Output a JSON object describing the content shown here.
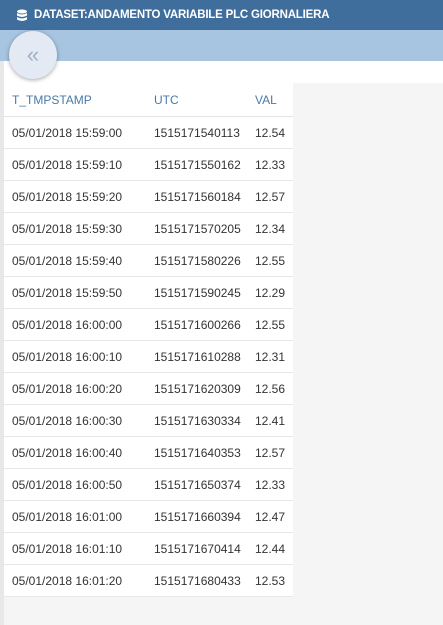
{
  "header": {
    "title": "DATASET:ANDAMENTO VARIABILE PLC GIORNALIERA",
    "icon": "database-icon"
  },
  "collapse_button": {
    "icon": "double-chevron-left-icon",
    "glyph": "«"
  },
  "table": {
    "columns": [
      "T_TMPSTAMP",
      "UTC",
      "VAL"
    ],
    "rows": [
      [
        "05/01/2018 15:59:00",
        "1515171540113",
        "12.54"
      ],
      [
        "05/01/2018 15:59:10",
        "1515171550162",
        "12.33"
      ],
      [
        "05/01/2018 15:59:20",
        "1515171560184",
        "12.57"
      ],
      [
        "05/01/2018 15:59:30",
        "1515171570205",
        "12.34"
      ],
      [
        "05/01/2018 15:59:40",
        "1515171580226",
        "12.55"
      ],
      [
        "05/01/2018 15:59:50",
        "1515171590245",
        "12.29"
      ],
      [
        "05/01/2018 16:00:00",
        "1515171600266",
        "12.55"
      ],
      [
        "05/01/2018 16:00:10",
        "1515171610288",
        "12.31"
      ],
      [
        "05/01/2018 16:00:20",
        "1515171620309",
        "12.56"
      ],
      [
        "05/01/2018 16:00:30",
        "1515171630334",
        "12.41"
      ],
      [
        "05/01/2018 16:00:40",
        "1515171640353",
        "12.57"
      ],
      [
        "05/01/2018 16:00:50",
        "1515171650374",
        "12.33"
      ],
      [
        "05/01/2018 16:01:00",
        "1515171660394",
        "12.47"
      ],
      [
        "05/01/2018 16:01:10",
        "1515171670414",
        "12.44"
      ],
      [
        "05/01/2018 16:01:20",
        "1515171680433",
        "12.53"
      ]
    ]
  },
  "colors": {
    "header_bg": "#3f6e9c",
    "subbar_bg": "#a7c4e0",
    "column_header_text": "#4a79a8"
  }
}
